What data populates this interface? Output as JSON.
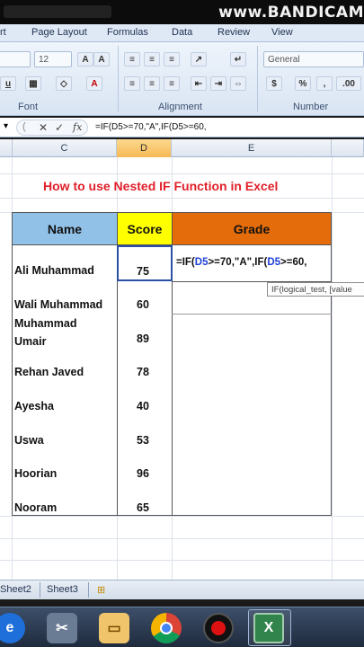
{
  "watermark": "www.BANDICAM",
  "ribbon": {
    "tabs": [
      "rt",
      "Page Layout",
      "Formulas",
      "Data",
      "Review",
      "View"
    ],
    "font_size": "12",
    "number_format": "General",
    "groups": [
      "Font",
      "Alignment",
      "Number"
    ]
  },
  "formula_bar": {
    "formula": "=IF(D5>=70,\"A\",IF(D5>=60,"
  },
  "columns": [
    "C",
    "D",
    "E"
  ],
  "heading": "How to use Nested IF Function in Excel",
  "table": {
    "headers": {
      "name": "Name",
      "score": "Score",
      "grade": "Grade"
    },
    "rows": [
      {
        "name": "Ali Muhammad",
        "score": "75"
      },
      {
        "name": "Wali Muhammad",
        "score": "60"
      },
      {
        "name": "Muhammad Umair",
        "score": "89"
      },
      {
        "name": "Rehan Javed",
        "score": "78"
      },
      {
        "name": "Ayesha",
        "score": "40"
      },
      {
        "name": "Uswa",
        "score": "53"
      },
      {
        "name": "Hoorian",
        "score": "96"
      },
      {
        "name": "Nooram",
        "score": "65"
      }
    ]
  },
  "editing": {
    "prefix": "=IF(",
    "ref1": "D5",
    "mid": ">=70,\"A\",IF(",
    "ref2": "D5",
    "suffix": ">=60,"
  },
  "tooltip": "IF(logical_test, [value",
  "sheet_tabs": [
    "Sheet2",
    "Sheet3"
  ],
  "colors": {
    "name_header": "#92c1e8",
    "score_header": "#ffff00",
    "grade_header": "#e46c0a",
    "heading_red": "#e0202a"
  }
}
